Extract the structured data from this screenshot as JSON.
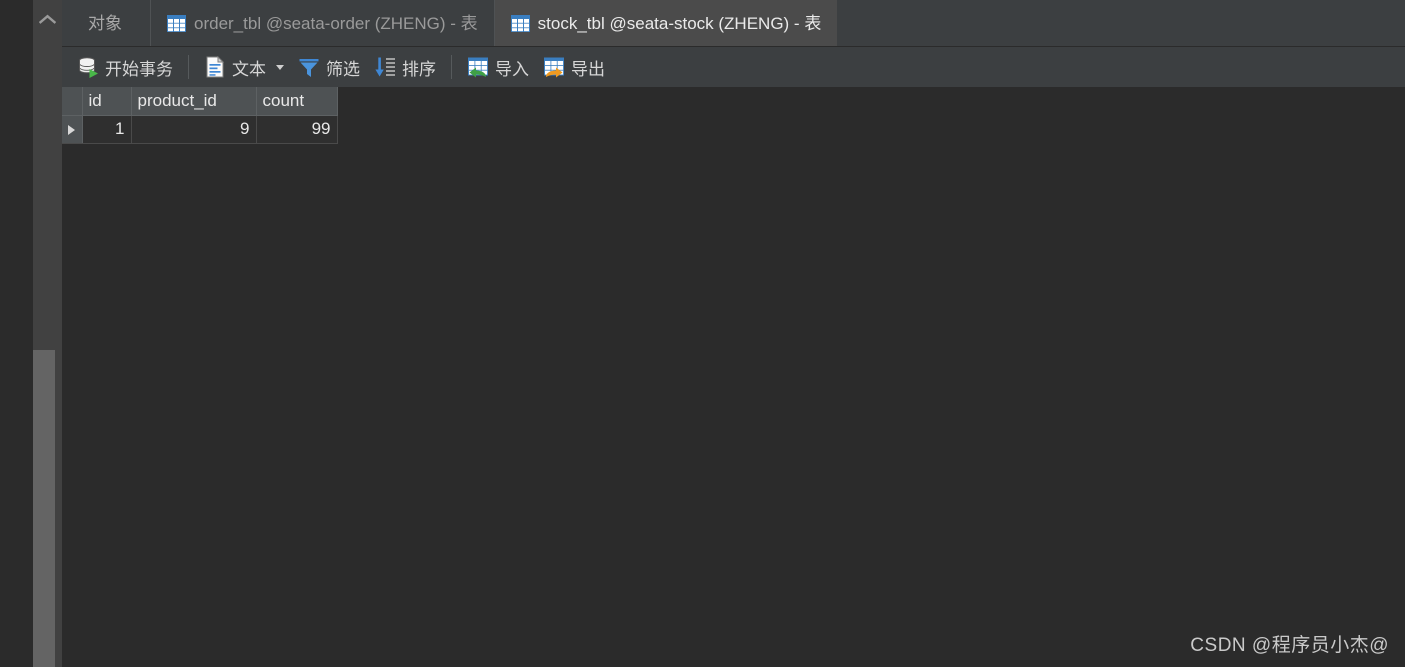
{
  "window": {
    "background_color": "#2b2b2b",
    "panel_color": "#3c3f41"
  },
  "sidebar": {
    "collapse_icon": "chevron-up-icon",
    "strip_color": "#414141",
    "thumb_color": "#646464"
  },
  "tabs": {
    "object_tab": {
      "label": "对象",
      "active": false
    },
    "items": [
      {
        "icon": "table-icon",
        "label": "order_tbl @seata-order (ZHENG) - 表",
        "active": false
      },
      {
        "icon": "table-icon",
        "label": "stock_tbl @seata-stock (ZHENG) - 表",
        "active": true
      }
    ],
    "active_color": "#4b4b4b",
    "inactive_text_color": "#9a9a9a",
    "active_text_color": "#eaeaea"
  },
  "toolbar": {
    "buttons": [
      {
        "icon": "database-play-icon",
        "label": "开始事务",
        "has_caret": false
      },
      {
        "icon": "text-document-icon",
        "label": "文本",
        "has_caret": true
      },
      {
        "icon": "filter-funnel-icon",
        "label": "筛选",
        "has_caret": false
      },
      {
        "icon": "sort-descending-icon",
        "label": "排序",
        "has_caret": false
      },
      {
        "icon": "import-grid-icon",
        "label": "导入",
        "has_caret": false
      },
      {
        "icon": "export-grid-icon",
        "label": "导出",
        "has_caret": false
      }
    ]
  },
  "grid": {
    "columns": [
      "id",
      "product_id",
      "count"
    ],
    "rows": [
      {
        "marker": "current-row-marker",
        "cells": [
          "1",
          "9",
          "99"
        ]
      }
    ],
    "header_bg": "#4e5254",
    "cell_bg": "#2f2f2f",
    "text_color": "#e8e8e8"
  },
  "watermark": {
    "text": "CSDN @程序员小杰@"
  }
}
